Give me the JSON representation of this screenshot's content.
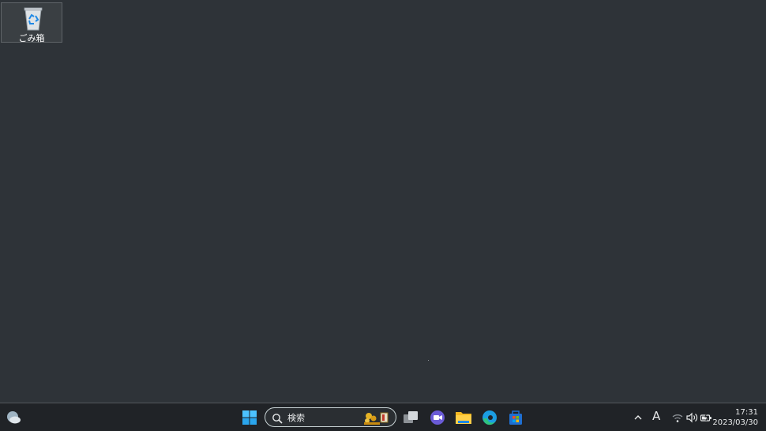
{
  "desktop": {
    "icons": [
      {
        "label": "ごみ箱",
        "icon": "recycle-bin-icon"
      }
    ]
  },
  "taskbar": {
    "widgets_icon": "weather-widget-icon",
    "start_icon": "windows-start-icon",
    "search": {
      "placeholder": "検索",
      "icon": "search-icon"
    },
    "apps": [
      {
        "name": "task-view",
        "icon": "task-view-icon"
      },
      {
        "name": "chat",
        "icon": "teams-chat-icon"
      },
      {
        "name": "file-explorer",
        "icon": "file-explorer-icon"
      },
      {
        "name": "edge",
        "icon": "edge-browser-icon"
      },
      {
        "name": "store",
        "icon": "microsoft-store-icon"
      }
    ],
    "tray": {
      "ime": "A",
      "time": "17:31",
      "date": "2023/03/30"
    }
  },
  "colors": {
    "desktop_bg": "#2e3338",
    "taskbar_bg": "#202327",
    "accent": "#4cc2ff"
  }
}
